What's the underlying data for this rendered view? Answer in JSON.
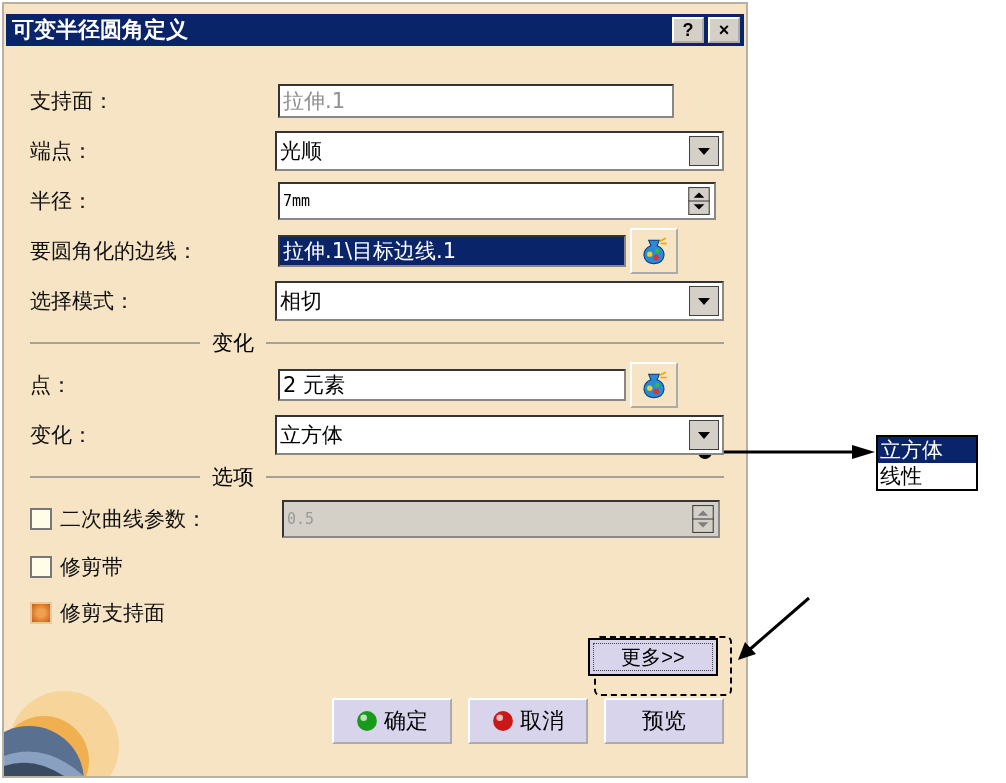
{
  "window": {
    "title": "可变半径圆角定义",
    "help": "?",
    "close": "×"
  },
  "rows": [
    {
      "kind": "text",
      "label": "支持面：",
      "value": "拉伸.1",
      "disabled": true
    },
    {
      "kind": "combo",
      "label": "端点：",
      "value": "光顺"
    },
    {
      "kind": "spin",
      "label": "半径：",
      "value": "7mm",
      "disabled": false
    },
    {
      "kind": "picker",
      "label": "要圆角化的边线：",
      "value": "拉伸.1\\目标边线.1",
      "selected": true
    },
    {
      "kind": "combo",
      "label": "选择模式：",
      "value": "相切"
    },
    {
      "kind": "section",
      "label": "变化"
    },
    {
      "kind": "picker",
      "label": "点：",
      "value": "2 元素",
      "selected": false
    },
    {
      "kind": "combo",
      "label": "变化：",
      "value": "立方体"
    },
    {
      "kind": "section",
      "label": "选项"
    },
    {
      "kind": "check-spin",
      "label": "二次曲线参数：",
      "checked": false,
      "value": "0.5",
      "disabled": true
    },
    {
      "kind": "check",
      "label": "修剪带",
      "checked": false
    },
    {
      "kind": "check",
      "label": "修剪支持面",
      "checked": true
    }
  ],
  "more_button": "更多>>",
  "buttons": [
    {
      "kind": "ok",
      "label": "确定"
    },
    {
      "kind": "cancel",
      "label": "取消"
    },
    {
      "kind": "plain",
      "label": "预览"
    }
  ],
  "dropdown_callout": {
    "options": [
      {
        "label": "立方体",
        "selected": true
      },
      {
        "label": "线性",
        "selected": false
      }
    ]
  }
}
